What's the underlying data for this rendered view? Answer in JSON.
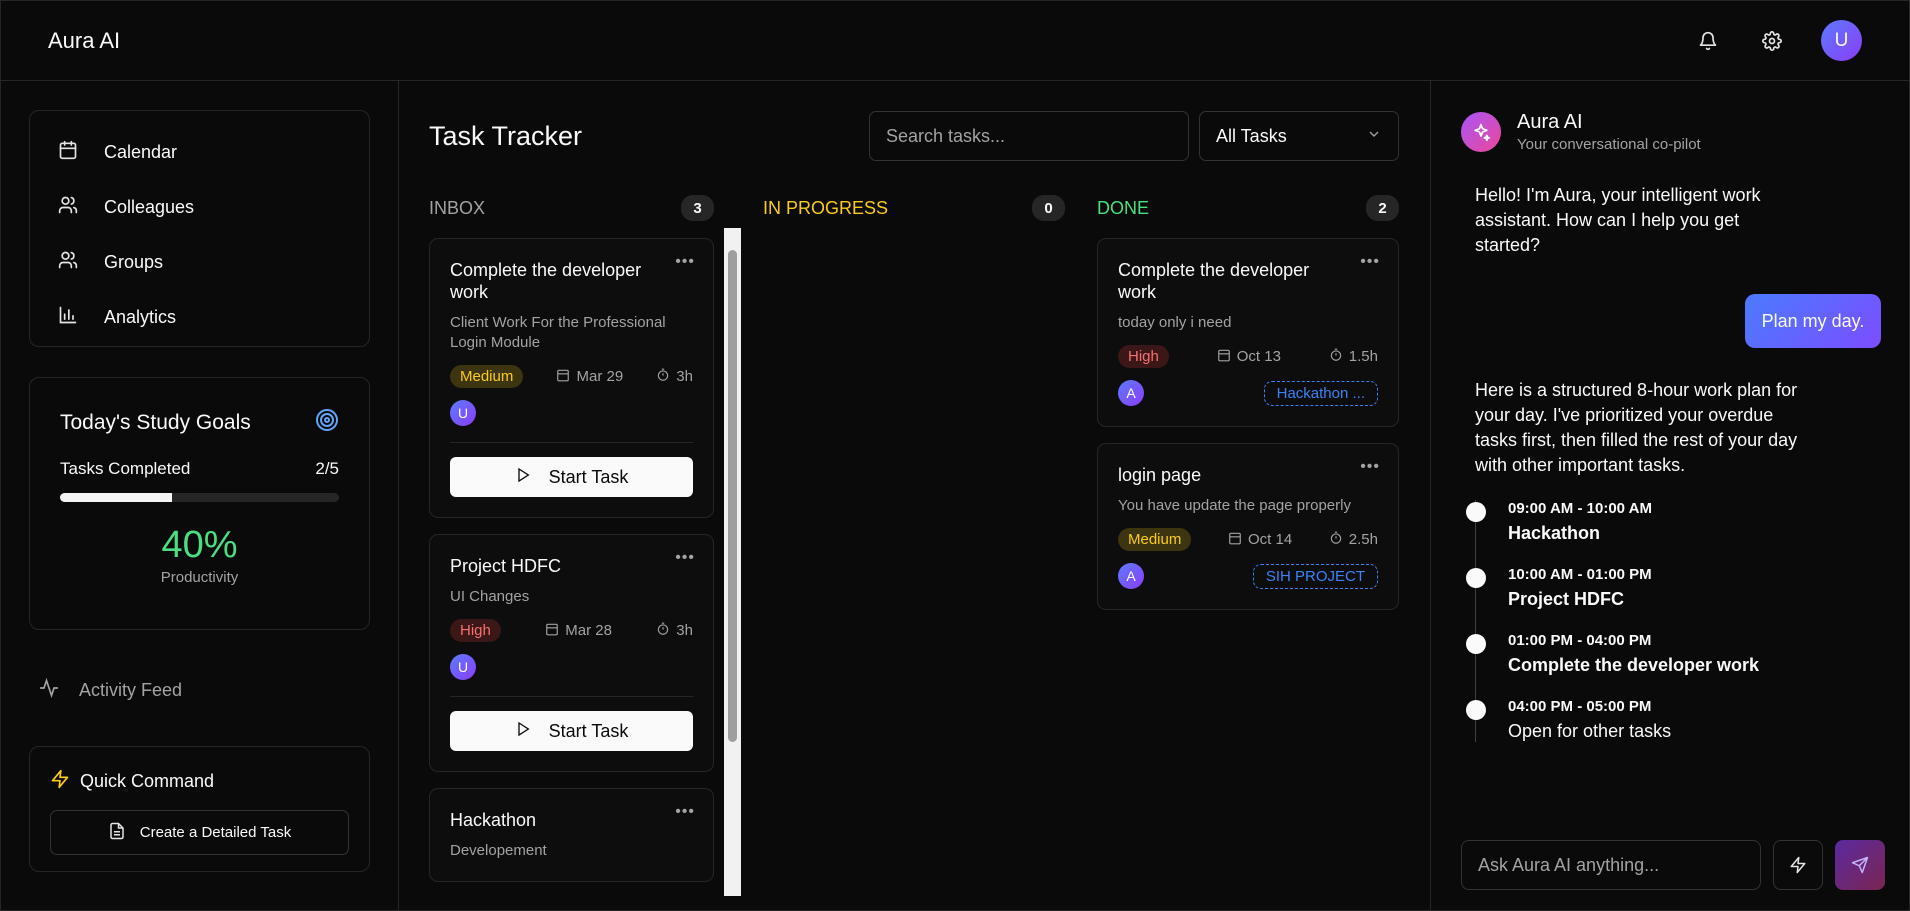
{
  "app": {
    "brand": "Aura AI",
    "user_initial": "U"
  },
  "sidebar": {
    "nav": [
      {
        "label": "Calendar",
        "icon": "calendar-icon"
      },
      {
        "label": "Colleagues",
        "icon": "users-icon"
      },
      {
        "label": "Groups",
        "icon": "users-icon"
      },
      {
        "label": "Analytics",
        "icon": "bar-chart-icon"
      }
    ],
    "goals": {
      "title": "Today's Study Goals",
      "tasks_label": "Tasks Completed",
      "tasks_value": "2/5",
      "progress_fraction": 0.4,
      "percent": "40%",
      "percent_label": "Productivity"
    },
    "activity_label": "Activity Feed",
    "quick": {
      "title": "Quick Command",
      "button": "Create a Detailed Task"
    }
  },
  "tracker": {
    "title": "Task Tracker",
    "search_placeholder": "Search tasks...",
    "filter": "All Tasks",
    "columns": {
      "inbox": {
        "label": "INBOX",
        "count": "3",
        "color": "#a3a3a3"
      },
      "progress": {
        "label": "IN PROGRESS",
        "count": "0",
        "color": "#facc15"
      },
      "done": {
        "label": "DONE",
        "count": "2",
        "color": "#4ade80"
      }
    },
    "inbox_cards": [
      {
        "title": "Complete the developer work",
        "desc": "Client Work For the Professional Login Module",
        "priority": "Medium",
        "date": "Mar 29",
        "duration": "3h",
        "assignee": "U",
        "action": "Start Task"
      },
      {
        "title": "Project HDFC",
        "desc": "UI Changes",
        "priority": "High",
        "date": "Mar 28",
        "duration": "3h",
        "assignee": "U",
        "action": "Start Task"
      },
      {
        "title": "Hackathon",
        "desc": "Developement"
      }
    ],
    "done_cards": [
      {
        "title": "Complete the developer work",
        "desc": "today only i need",
        "priority": "High",
        "date": "Oct 13",
        "duration": "1.5h",
        "assignee": "A",
        "tag": "Hackathon ..."
      },
      {
        "title": "login page",
        "desc": "You have update the page properly",
        "priority": "Medium",
        "date": "Oct 14",
        "duration": "2.5h",
        "assignee": "A",
        "tag": "SIH PROJECT"
      }
    ]
  },
  "assistant": {
    "name": "Aura AI",
    "subtitle": "Your conversational co-pilot",
    "greeting": "Hello! I'm Aura, your intelligent work assistant. How can I help you get started?",
    "user_message": "Plan my day.",
    "plan_intro": "Here is a structured 8-hour work plan for your day. I've prioritized your overdue tasks first, then filled the rest of your day with other important tasks.",
    "plan": [
      {
        "time": "09:00 AM - 10:00 AM",
        "task": "Hackathon"
      },
      {
        "time": "10:00 AM - 01:00 PM",
        "task": "Project HDFC"
      },
      {
        "time": "01:00 PM - 04:00 PM",
        "task": "Complete the developer work"
      },
      {
        "time": "04:00 PM - 05:00 PM",
        "task": "Open for other tasks"
      }
    ],
    "input_placeholder": "Ask Aura AI anything..."
  }
}
